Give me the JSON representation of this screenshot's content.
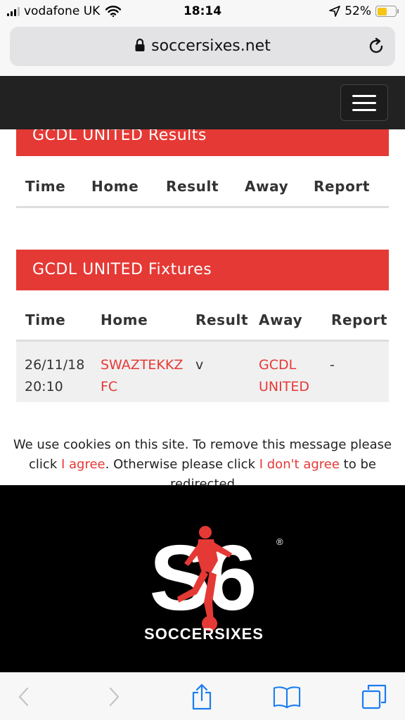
{
  "status_bar": {
    "carrier": "vodafone UK",
    "time": "18:14",
    "battery_percent": "52%",
    "battery_level": 0.52,
    "battery_color": "#f5c518"
  },
  "browser": {
    "url": "soccersixes.net",
    "lock_icon": "lock-icon",
    "reload_icon": "reload-icon"
  },
  "navbar": {
    "menu_icon": "hamburger-menu-icon"
  },
  "results": {
    "heading": "GCDL UNITED Results",
    "columns": [
      "Time",
      "Home",
      "Result",
      "Away",
      "Report"
    ]
  },
  "fixtures": {
    "heading": "GCDL UNITED Fixtures",
    "columns": [
      "Time",
      "Home",
      "Result",
      "Away",
      "Report"
    ],
    "rows": [
      {
        "time": "26/11/18 20:10",
        "home": "SWAZTEKKZ FC",
        "result": "v",
        "away": "GCDL UNITED",
        "report": "-"
      }
    ]
  },
  "cookie": {
    "text_before": "We use cookies on this site. To remove this message please click ",
    "agree_link": "I agree",
    "text_middle": ". Otherwise please click ",
    "disagree_link": "I don't agree",
    "text_after": " to be redirected"
  },
  "footer": {
    "logo_monogram": "S6",
    "logo_text": "SOCCERSIXES",
    "registered_mark": "®"
  },
  "colors": {
    "accent_red": "#e53935",
    "navbar_bg": "#222222",
    "footer_bg": "#000000",
    "ios_blue": "#1a7cf0"
  }
}
